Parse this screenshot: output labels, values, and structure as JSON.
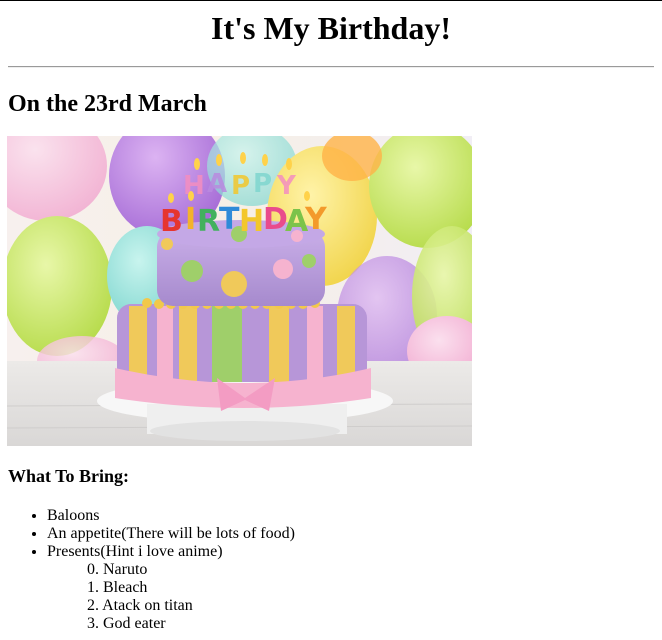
{
  "page": {
    "title": "It's My Birthday!",
    "date": "On the 23rd March"
  },
  "image": {
    "alt": "Birthday cake with Happy Birthday candles and balloons",
    "candle_text_top": "HAPPY",
    "candle_text_bottom": "BIRTHDAY"
  },
  "bring": {
    "heading": "What To Bring:",
    "items": [
      "Baloons",
      "An appetite(There will be lots of food)",
      "Presents(Hint i love anime)"
    ],
    "anime": [
      {
        "num": "0.",
        "name": "Naruto"
      },
      {
        "num": "1.",
        "name": "Bleach"
      },
      {
        "num": "2.",
        "name": "Atack on titan"
      },
      {
        "num": "3.",
        "name": "God eater"
      }
    ]
  },
  "colors": {
    "cake_purple": "#b796d8",
    "ribbon_pink": "#f6b3cf",
    "stripe_yellow": "#f0c95a",
    "stripe_green": "#9fcf6a"
  }
}
